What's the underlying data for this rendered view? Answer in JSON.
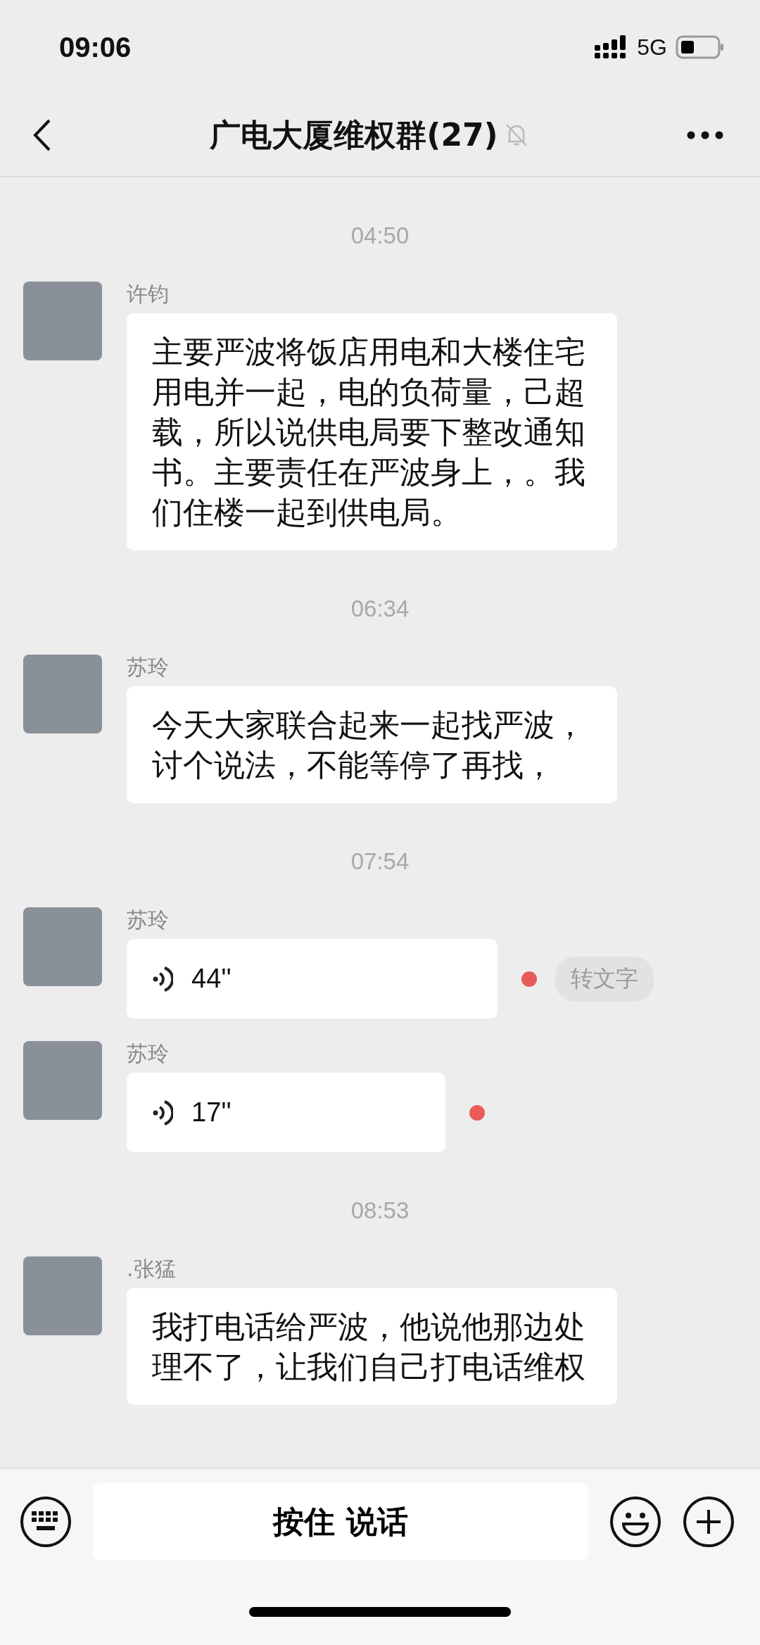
{
  "status_bar": {
    "time": "09:06",
    "network": "5G"
  },
  "header": {
    "title": "广电大厦维权群(27)",
    "muted": true
  },
  "messages": [
    {
      "kind": "time",
      "text": "04:50"
    },
    {
      "kind": "text",
      "sender": "许钧",
      "text": "主要严波将饭店用电和大楼住宅用电并一起，电的负荷量，己超载，所以说供电局要下整改通知书。主要责任在严波身上，。我们住楼一起到供电局。"
    },
    {
      "kind": "time",
      "text": "06:34"
    },
    {
      "kind": "text",
      "sender": "苏玲",
      "text": "今天大家联合起来一起找严波，讨个说法，不能等停了再找，"
    },
    {
      "kind": "time",
      "text": "07:54"
    },
    {
      "kind": "voice",
      "sender": "苏玲",
      "duration": "44''",
      "unread": true,
      "transcribe": "转文字"
    },
    {
      "kind": "voice",
      "sender": "苏玲",
      "duration": "17''",
      "unread": true
    },
    {
      "kind": "time",
      "text": "08:53"
    },
    {
      "kind": "text",
      "sender": ".张猛",
      "text": "我打电话给严波，他说他那边处理不了，让我们自己打电话维权"
    }
  ],
  "input_bar": {
    "hold_to_talk": "按住 说话"
  }
}
